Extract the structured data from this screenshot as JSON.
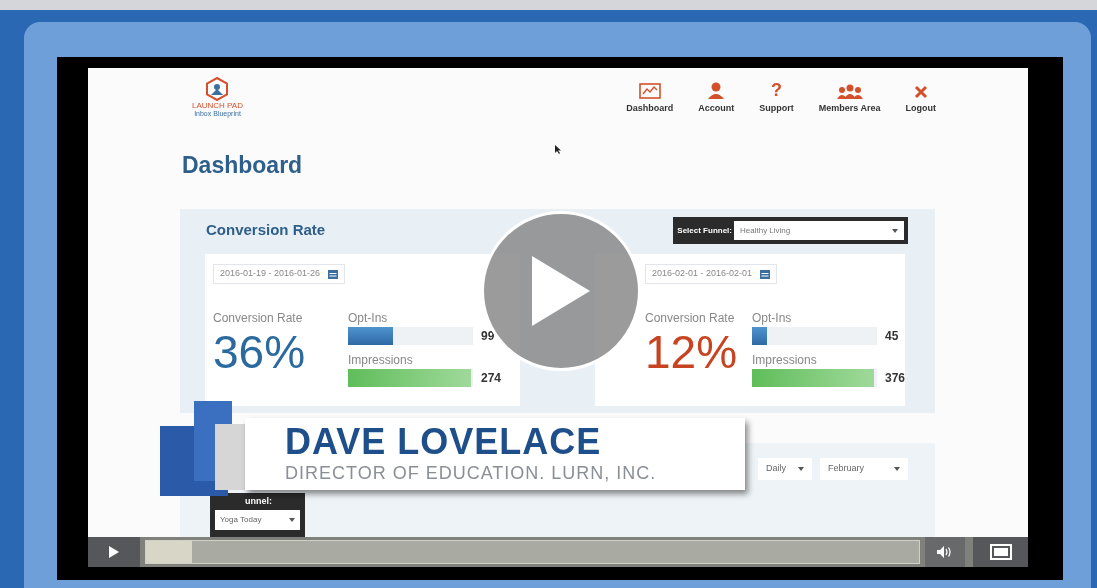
{
  "logo": {
    "title": "LAUNCH PAD",
    "subtitle": "Inbox Blueprint"
  },
  "nav": [
    {
      "kind": "dashboard",
      "label": "Dashboard"
    },
    {
      "kind": "account",
      "label": "Account"
    },
    {
      "kind": "support",
      "label": "Support",
      "glyph": "?"
    },
    {
      "kind": "members",
      "label": "Members Area"
    },
    {
      "kind": "logout",
      "label": "Logout"
    }
  ],
  "page_title": "Dashboard",
  "conversion_panel": {
    "title": "Conversion Rate",
    "funnel_select": {
      "label": "Select Funnel:",
      "value": "Healthy Living"
    },
    "cards": [
      {
        "date_range": "2016-01-19 - 2016-01-26",
        "rate_label": "Conversion Rate",
        "rate": "36%",
        "color": "#2b6a9e",
        "optins": {
          "label": "Opt-Ins",
          "value": "99",
          "level": 0.36
        },
        "impressions": {
          "label": "Impressions",
          "value": "274",
          "level": 0.98
        }
      },
      {
        "date_range": "2016-02-01 - 2016-02-01",
        "rate_label": "Conversion Rate",
        "rate": "12%",
        "color": "#c8431f",
        "optins": {
          "label": "Opt-Ins",
          "value": "45",
          "level": 0.12
        },
        "impressions": {
          "label": "Impressions",
          "value": "376",
          "level": 0.98
        }
      }
    ]
  },
  "lower_panel": {
    "selects": [
      {
        "value": "Daily"
      },
      {
        "value": "February"
      }
    ],
    "funnel_label": "unnel:",
    "funnel_value": "Yoga Today"
  },
  "banner": {
    "name": "DAVE LOVELACE",
    "role": "DIRECTOR OF EDUCATION. LURN, INC."
  },
  "player": {
    "paused": true,
    "progress": {
      "level": 0.06
    }
  }
}
